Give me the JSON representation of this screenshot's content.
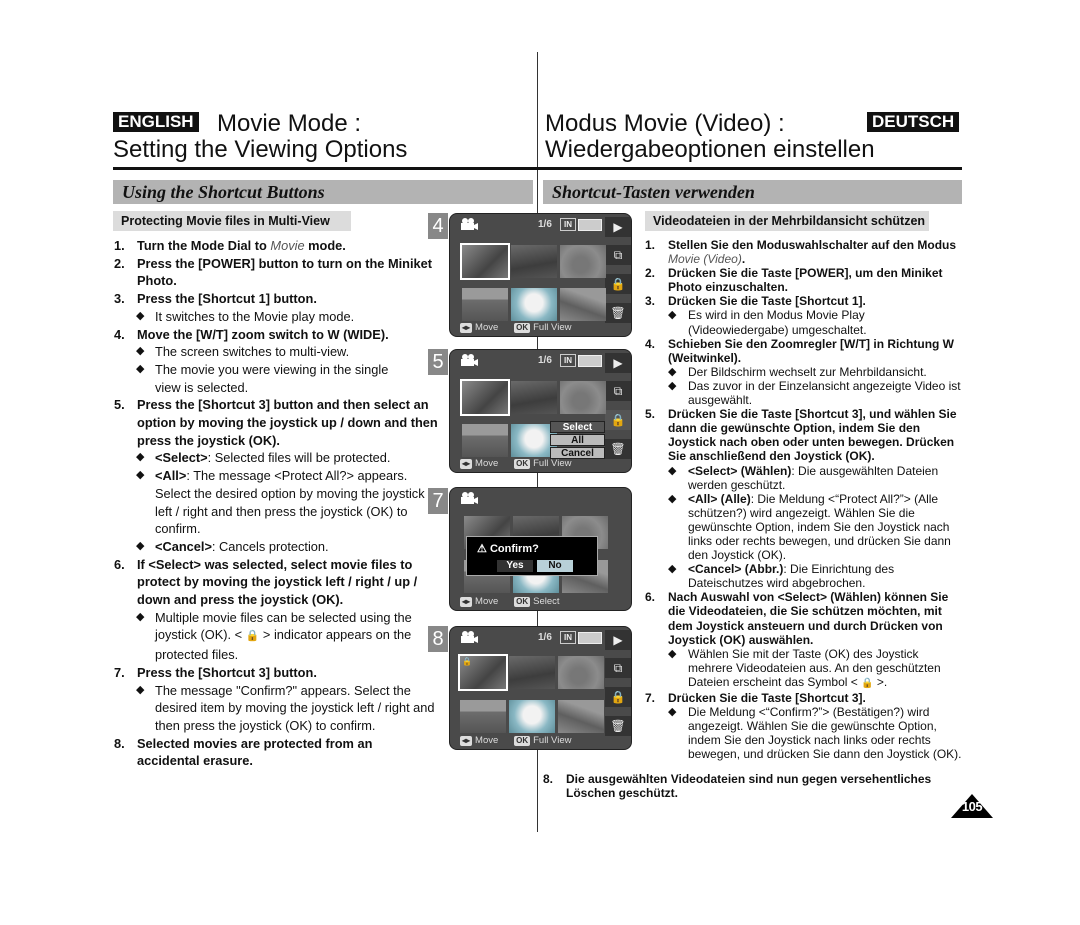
{
  "header": {
    "en_badge": "ENGLISH",
    "en_title_1": "Movie Mode :",
    "en_title_2": "Setting the Viewing Options",
    "de_badge": "DEUTSCH",
    "de_title_1": "Modus Movie (Video) :",
    "de_title_2": "Wiedergabeoptionen einstellen"
  },
  "sections": {
    "en": "Using the Shortcut Buttons",
    "de": "Shortcut-Tasten verwenden"
  },
  "en": {
    "subheading": "Protecting Movie files in Multi-View",
    "s1_num": "1.",
    "s1_a": "Turn the Mode Dial to ",
    "s1_b": "Movie",
    "s1_c": " mode.",
    "s2_num": "2.",
    "s2": "Press the [POWER] button to turn on the Miniket Photo.",
    "s3_num": "3.",
    "s3": "Press the [Shortcut 1] button.",
    "s3_b1": "It switches to the Movie play mode.",
    "s4_num": "4.",
    "s4": "Move the [W/T] zoom switch to W (WIDE).",
    "s4_b1": "The screen switches to multi-view.",
    "s4_b2": "The movie you were viewing in the single view is selected.",
    "s5_num": "5.",
    "s5": "Press the [Shortcut 3] button and then select an option by moving the joystick up / down and then press the joystick (OK).",
    "s5_b1_k": "<Select>",
    "s5_b1": ": Selected files will be protected.",
    "s5_b2_k": "<All>",
    "s5_b2": ": The message <Protect All?> appears. Select the desired option by moving the joystick left / right and then press the joystick (OK) to confirm.",
    "s5_b3_k": "<Cancel>",
    "s5_b3": ": Cancels protection.",
    "s6_num": "6.",
    "s6": "If <Select> was selected, select movie files to protect by moving the joystick left / right / up / down and press the joystick (OK).",
    "s6_b1_a": "Multiple movie files can be selected using the joystick (OK). < ",
    "s6_b1_b": " > indicator appears on the protected files.",
    "s7_num": "7.",
    "s7": "Press the [Shortcut 3] button.",
    "s7_b1": "The message \"Confirm?\" appears. Select the desired item by moving the joystick left / right and then press the joystick (OK) to confirm.",
    "s8_num": "8.",
    "s8": "Selected movies are protected from an accidental erasure."
  },
  "de": {
    "subheading": "Videodateien in der Mehrbildansicht schützen",
    "s1_num": "1.",
    "s1_a": "Stellen Sie den Moduswahlschalter auf den Modus ",
    "s1_b": "Movie (Video)",
    "s1_c": ".",
    "s2_num": "2.",
    "s2": "Drücken Sie die Taste [POWER], um den Miniket Photo einzuschalten.",
    "s3_num": "3.",
    "s3": "Drücken Sie die Taste [Shortcut 1].",
    "s3_b1": "Es wird in den Modus Movie Play (Videowiedergabe) umgeschaltet.",
    "s4_num": "4.",
    "s4": "Schieben Sie den Zoomregler [W/T] in Richtung W (Weitwinkel).",
    "s4_b1": "Der Bildschirm wechselt zur Mehrbildansicht.",
    "s4_b2": "Das zuvor in der Einzelansicht angezeigte Video ist ausgewählt.",
    "s5_num": "5.",
    "s5": "Drücken Sie die Taste [Shortcut 3], und wählen Sie dann die gewünschte Option, indem Sie den Joystick nach oben oder unten bewegen. Drücken Sie anschließend den Joystick (OK).",
    "s5_b1_k": "<Select> (Wählen)",
    "s5_b1": ": Die ausgewählten Dateien werden geschützt.",
    "s5_b2_k": "<All> (Alle)",
    "s5_b2": ": Die Meldung <“Protect All?”> (Alle schützen?) wird angezeigt. Wählen Sie die gewünschte Option, indem Sie den Joystick nach links oder rechts bewegen, und drücken Sie dann den Joystick (OK).",
    "s5_b3_k": "<Cancel> (Abbr.)",
    "s5_b3": ": Die Einrichtung des Dateischutzes wird abgebrochen.",
    "s6_num": "6.",
    "s6": "Nach Auswahl von <Select> (Wählen) können Sie die Videodateien, die Sie schützen möchten, mit dem Joystick ansteuern und durch Drücken von Joystick (OK) auswählen.",
    "s6_b1_a": "Wählen Sie mit der Taste (OK) des Joystick mehrere Videodateien aus. An den geschützten Dateien erscheint das Symbol < ",
    "s6_b1_b": " >.",
    "s7_num": "7.",
    "s7": "Drücken Sie die Taste [Shortcut 3].",
    "s7_b1": "Die Meldung <“Confirm?”> (Bestätigen?) wird angezeigt. Wählen Sie die gewünschte Option, indem Sie den Joystick nach links oder rechts bewegen, und drücken Sie dann den Joystick (OK).",
    "s8_num": "8.",
    "s8": "Die ausgewählten Videodateien sind nun gegen versehentliches Löschen geschützt."
  },
  "screens": [
    {
      "step": "4",
      "counter": "1/6",
      "in": "IN",
      "move": "Move",
      "ok": "OK",
      "action": "Full View"
    },
    {
      "step": "5",
      "counter": "1/6",
      "in": "IN",
      "move": "Move",
      "ok": "OK",
      "action": "Full View",
      "menu": [
        "Select",
        "All",
        "Cancel"
      ]
    },
    {
      "step": "7",
      "move": "Move",
      "ok": "OK",
      "action": "Select",
      "confirm_msg": "Confirm?",
      "yes": "Yes",
      "no": "No"
    },
    {
      "step": "8",
      "counter": "1/6",
      "in": "IN",
      "move": "Move",
      "ok": "OK",
      "action": "Full View"
    }
  ],
  "icons": {
    "play": "▶",
    "multi": "⧉",
    "lock": "🔒",
    "trash": "🗑",
    "warning": "⚠",
    "bullet": "◆"
  },
  "page_number": "105"
}
